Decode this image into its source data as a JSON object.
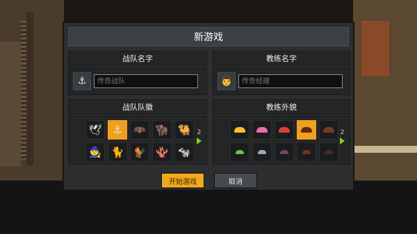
{
  "dialog": {
    "title": "新游戏"
  },
  "team_name": {
    "header": "战队名字",
    "placeholder": "传奇战队",
    "icon": "anchor-icon"
  },
  "coach_name": {
    "header": "教练名字",
    "placeholder": "传奇经理",
    "icon": "coach-avatar-icon"
  },
  "team_logo": {
    "header": "战队队徽",
    "page": "2",
    "items": [
      {
        "icon": "seagull-icon",
        "glyph": "🕊",
        "selected": false
      },
      {
        "icon": "anchor-icon",
        "glyph": "⚓",
        "selected": true
      },
      {
        "icon": "bat-icon",
        "glyph": "🦇",
        "selected": false
      },
      {
        "icon": "bison-icon",
        "glyph": "🦬",
        "selected": false
      },
      {
        "icon": "camel-icon",
        "glyph": "🐫",
        "selected": false
      },
      {
        "icon": "wizard-icon",
        "glyph": "🧙",
        "selected": false
      },
      {
        "icon": "cat-icon",
        "glyph": "🐈",
        "selected": false
      },
      {
        "icon": "rooster-icon",
        "glyph": "🐓",
        "selected": false
      },
      {
        "icon": "coral-icon",
        "glyph": "🪸",
        "selected": false
      },
      {
        "icon": "cow-icon",
        "glyph": "🐄",
        "selected": false
      }
    ]
  },
  "coach_look": {
    "header": "教练外貌",
    "page": "2",
    "items": [
      {
        "icon": "hair-yellow-icon",
        "color": "#f2c230",
        "selected": false
      },
      {
        "icon": "hair-pink-icon",
        "color": "#ee6ab0",
        "selected": false
      },
      {
        "icon": "hair-red-icon",
        "color": "#d6423a",
        "selected": false
      },
      {
        "icon": "hair-brown-icon",
        "color": "#5a2a14",
        "selected": true
      },
      {
        "icon": "hair-darkred-icon",
        "color": "#7a3a2a",
        "selected": false
      },
      {
        "icon": "hair-green-icon",
        "color": "#6cc044",
        "selected": false
      },
      {
        "icon": "hair-gray-icon",
        "color": "#a0a8b0",
        "selected": false
      },
      {
        "icon": "hair-purple-icon",
        "color": "#6a4a6a",
        "selected": false
      },
      {
        "icon": "hair-maroon-icon",
        "color": "#7a2e2a",
        "selected": false
      },
      {
        "icon": "hair-dark-icon",
        "color": "#4a2a2a",
        "selected": false
      }
    ]
  },
  "buttons": {
    "start": "开始游戏",
    "cancel": "取消"
  },
  "colors": {
    "accent": "#f2a71e",
    "arrow": "#7ed321",
    "dialog": "#2c2e30"
  }
}
